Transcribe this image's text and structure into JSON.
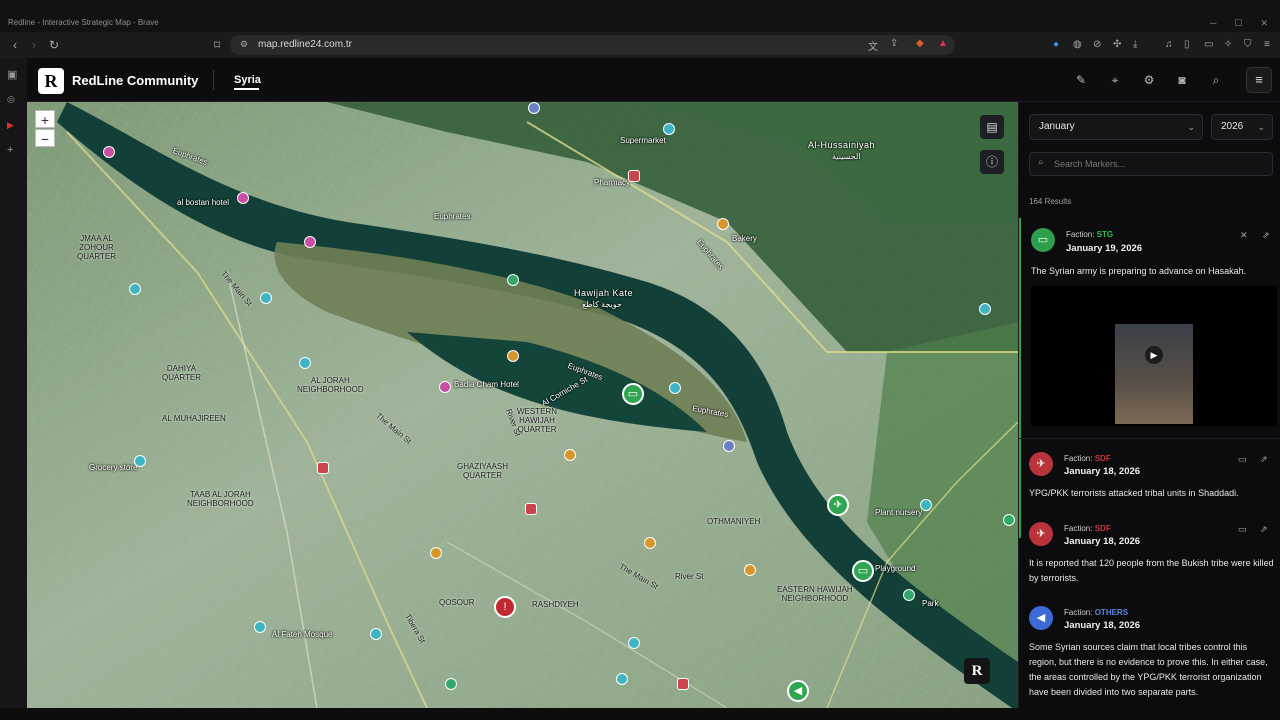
{
  "window": {
    "title": "Redline - Interactive Strategic Map - Brave"
  },
  "browser": {
    "url": "map.redline24.com.tr",
    "icons": [
      "back-icon",
      "forward-icon",
      "reload-icon",
      "bookmark-icon",
      "translate-icon",
      "share-icon",
      "brave-shields-icon",
      "brave-rewards-icon"
    ]
  },
  "app": {
    "brand": "RedLine Community",
    "logo_letter": "R",
    "nav": {
      "syria": "Syria"
    },
    "header_icons": [
      "pen-icon",
      "location-pin-icon",
      "settings-icon",
      "camera-icon",
      "search-icon",
      "menu-icon"
    ]
  },
  "map": {
    "zoom_in": "+",
    "zoom_out": "−",
    "labels": {
      "euphrates_1": "Euphrates",
      "euphrates_2": "Euphrates",
      "euphrates_3": "Euphrates",
      "euphrates_4": "Euphrates",
      "euphrates_5": "Euphrates",
      "hawijah_kate": "Hawijah Kate",
      "hawijah_kate_ar": "حويجة كاطع",
      "al_hussainiyah": "Al-Hussainiyah",
      "al_hussainiyah_ar": "الحسينية",
      "jmaa_el_zohour": "JMAA AL\nZOHOUR\nQUARTER",
      "dahiya": "DAHIYA\nQUARTER",
      "al_jorah": "AL JORAH\nNEIGHBORHOOD",
      "al_muhajireen": "AL MUHAJIREEN",
      "taab_al_jorah": "TAAB AL JORAH\nNEIGHBORHOOD",
      "western_hawijah": "WESTERN\nHAWIJAH\nQUARTER",
      "ghaziyaash": "GHAZIYAASH\nQUARTER",
      "othmaniyeh": "OTHMANIYEH",
      "eastern_hawijah": "EASTERN HAWIJAH\nNEIGHBORHOOD",
      "qosour": "QOSOUR",
      "rashdiyeh": "RASHDIYEH",
      "badia_cham": "Badia Cham Hotel",
      "al_bostan": "al bostan hotel",
      "supermarket": "Supermarket",
      "pharmacy": "Pharmacy",
      "bakery": "Bakery",
      "grocery": "Grocery store",
      "al_fateh_mosque": "Al Fateh Mosque",
      "plant_nursery": "Plant nursery",
      "playground": "Playground",
      "park": "Park",
      "river_st_1": "River St",
      "river_st_2": "River St",
      "the_main_st_1": "The Main St",
      "the_main_st_2": "The Main St",
      "the_main_st_3": "The Main St",
      "al_corniche": "Al Corniche St",
      "tiberia": "Tibera St"
    },
    "badge_letter": "R"
  },
  "panel": {
    "month": "January",
    "year": "2026",
    "search_placeholder": "Search Markers...",
    "results": "164 Results",
    "faction_label": "Faction:",
    "cards": [
      {
        "faction": "STG",
        "faction_color": "#2fbf5a",
        "date": "January 19, 2026",
        "text": "The Syrian army is preparing to advance on Hasakah.",
        "avatar_color": "#2e9f4c"
      },
      {
        "faction": "SDF",
        "faction_color": "#c93a3a",
        "date": "January 18, 2026",
        "text": "YPG/PKK terrorists attacked tribal units in Shaddadi.",
        "avatar_color": "#b8333a"
      },
      {
        "faction": "SDF",
        "faction_color": "#c93a3a",
        "date": "January 18, 2026",
        "text": "It is reported that 120 people from the Bukish tribe were killed by terrorists.",
        "avatar_color": "#b8333a"
      },
      {
        "faction": "OTHERS",
        "faction_color": "#5a86e0",
        "date": "January 18, 2026",
        "text": "Some Syrian sources claim that local tribes control this region, but there is no evidence to prove this. In either case, the areas controlled by the YPG/PKK terrorist organization have been divided into two separate parts.",
        "avatar_color": "#3d6ad6"
      }
    ]
  }
}
